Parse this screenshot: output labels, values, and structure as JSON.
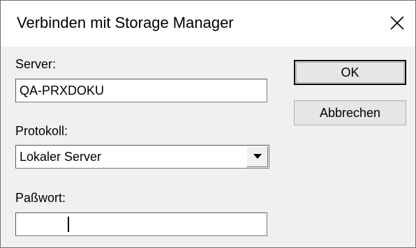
{
  "window": {
    "title": "Verbinden mit Storage Manager",
    "close_icon": "close-icon"
  },
  "form": {
    "server_label": "Server:",
    "server_value": "QA-PRXDOKU",
    "protocol_label": "Protokoll:",
    "protocol_selected": "Lokaler Server",
    "password_label": "Paßwort:",
    "password_masked": "********"
  },
  "buttons": {
    "ok_label": "OK",
    "cancel_label": "Abbrechen"
  },
  "colors": {
    "dialog_bg": "#f0f0f0",
    "titlebar_bg": "#ffffff",
    "button_bg": "#e6e6e6"
  }
}
